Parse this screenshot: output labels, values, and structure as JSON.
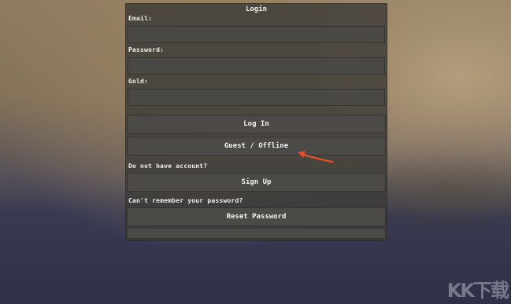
{
  "dialog": {
    "title": "Login",
    "email_label": "Email:",
    "email_value": "",
    "password_label": "Password:",
    "password_value": "",
    "gold_label": "Gold:",
    "gold_value": "",
    "login_button": "Log In",
    "guest_button": "Guest / Offline",
    "no_account_text": "Do not have account?",
    "signup_button": "Sign Up",
    "forgot_text": "Can't remember your password?",
    "reset_button": "Reset Password"
  },
  "annotation": {
    "arrow_color": "#e0502e"
  },
  "watermark": {
    "text": "KK下载"
  },
  "colors": {
    "panel": "#3c3a37",
    "field": "#4a4845",
    "button": "#4c4a46",
    "text": "#f2f2f2"
  }
}
